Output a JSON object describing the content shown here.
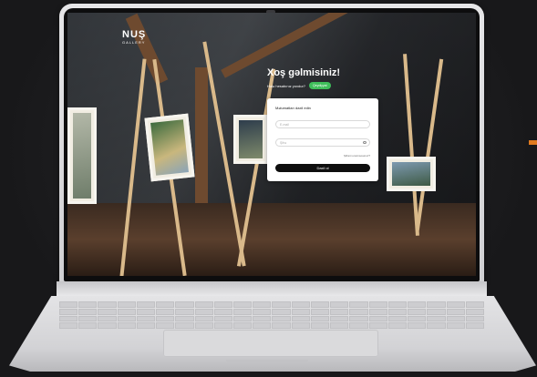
{
  "app": {
    "logo_main": "NUŞ",
    "logo_sub": "GALLERY"
  },
  "hero": {
    "welcome_title": "Xoş gəlmisiniz!",
    "no_account_text": "Hələ hesabınız yoxdur?",
    "signup_label": "Qeydiyyat"
  },
  "login_card": {
    "title": "Məlumatları daxil edin",
    "email_placeholder": "E-mail",
    "password_placeholder": "Şifrə",
    "forgot_label": "Şifrəni unutmusunuz?",
    "login_label": "Daxil ol"
  },
  "colors": {
    "signup_bg": "#3fbf5a",
    "login_bg": "#0e0e0e",
    "accent": "#e07a1f"
  }
}
